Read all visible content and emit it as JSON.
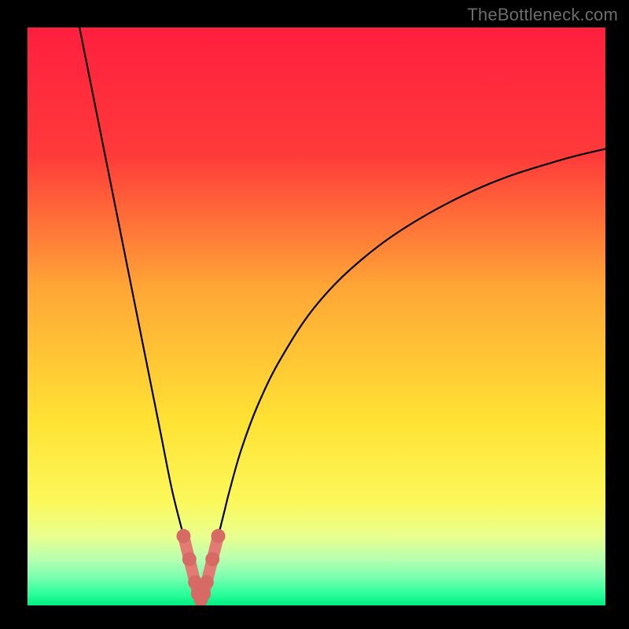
{
  "watermark": {
    "text": "TheBottleneck.com"
  },
  "chart_data": {
    "type": "line",
    "title": "",
    "xlabel": "",
    "ylabel": "",
    "xlim": [
      0,
      100
    ],
    "ylim": [
      0,
      100
    ],
    "grid": false,
    "legend": false,
    "background_gradient_stops": [
      {
        "pct": 0,
        "color": "#ff1f3f"
      },
      {
        "pct": 22,
        "color": "#ff3a3a"
      },
      {
        "pct": 45,
        "color": "#ffa636"
      },
      {
        "pct": 68,
        "color": "#ffe233"
      },
      {
        "pct": 82,
        "color": "#fbf85a"
      },
      {
        "pct": 88,
        "color": "#e9ff8e"
      },
      {
        "pct": 92,
        "color": "#b8ffb0"
      },
      {
        "pct": 95,
        "color": "#7dffb0"
      },
      {
        "pct": 98,
        "color": "#2bff9a"
      },
      {
        "pct": 100,
        "color": "#00ef82"
      }
    ],
    "series": [
      {
        "name": "bottleneck-curve",
        "style": "thin-black",
        "x": [
          9.0,
          11.0,
          13.0,
          15.0,
          17.0,
          19.0,
          21.0,
          23.0,
          25.0,
          27.0,
          28.0,
          29.0,
          29.5,
          30.0,
          30.5,
          31.0,
          32.0,
          33.0,
          34.0,
          35.0,
          37.0,
          40.0,
          44.0,
          50.0,
          58.0,
          68.0,
          80.0,
          92.0,
          100.0
        ],
        "values": [
          100.0,
          90.0,
          80.0,
          70.0,
          60.0,
          50.0,
          40.0,
          30.0,
          20.0,
          12.0,
          8.0,
          4.0,
          2.0,
          1.0,
          2.0,
          4.0,
          8.0,
          12.0,
          16.0,
          20.0,
          27.0,
          35.0,
          43.0,
          52.0,
          60.0,
          67.0,
          73.0,
          77.0,
          79.0
        ]
      },
      {
        "name": "bottleneck-minimum-region",
        "style": "thick-salmon-dotted",
        "x": [
          27.0,
          28.0,
          29.0,
          29.5,
          30.0,
          30.5,
          31.0,
          32.0,
          33.0
        ],
        "values": [
          12.0,
          8.0,
          4.0,
          2.0,
          1.0,
          2.0,
          4.0,
          8.0,
          12.0
        ]
      }
    ],
    "minimum_point": {
      "x": 30.0,
      "value": 1.0
    }
  }
}
